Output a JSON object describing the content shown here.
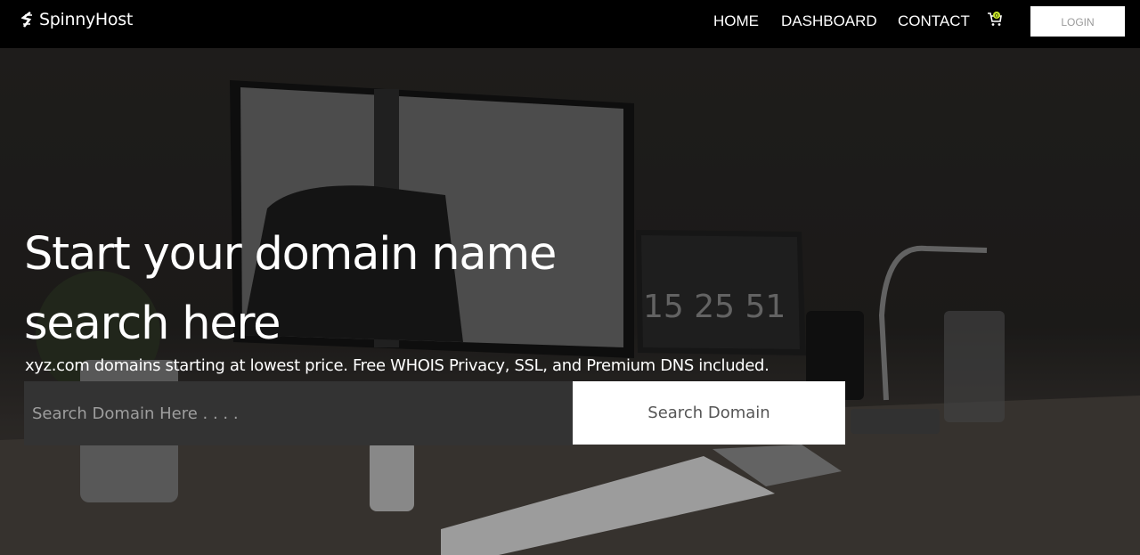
{
  "brand": {
    "name": "SpinnyHost",
    "icon": "s-logo-icon"
  },
  "nav": {
    "links": [
      {
        "label": "HOME"
      },
      {
        "label": "DASHBOARD"
      },
      {
        "label": "CONTACT"
      }
    ],
    "cart_icon": "cart-icon",
    "cart_count": "0",
    "login_label": "LOGIN"
  },
  "hero": {
    "headline_line1": "Start your domain name",
    "headline_line2": "search here",
    "subline": "xyz.com domains starting at lowest price. Free WHOIS Privacy, SSL, and Premium DNS included.",
    "search_placeholder": "Search Domain Here . . . .",
    "search_button": "Search Domain",
    "clock_text": "15 25 51"
  },
  "colors": {
    "nav_bg": "#000000",
    "cart_badge": "#c8e62a",
    "input_bg": "#333333",
    "button_bg": "#ffffff"
  }
}
